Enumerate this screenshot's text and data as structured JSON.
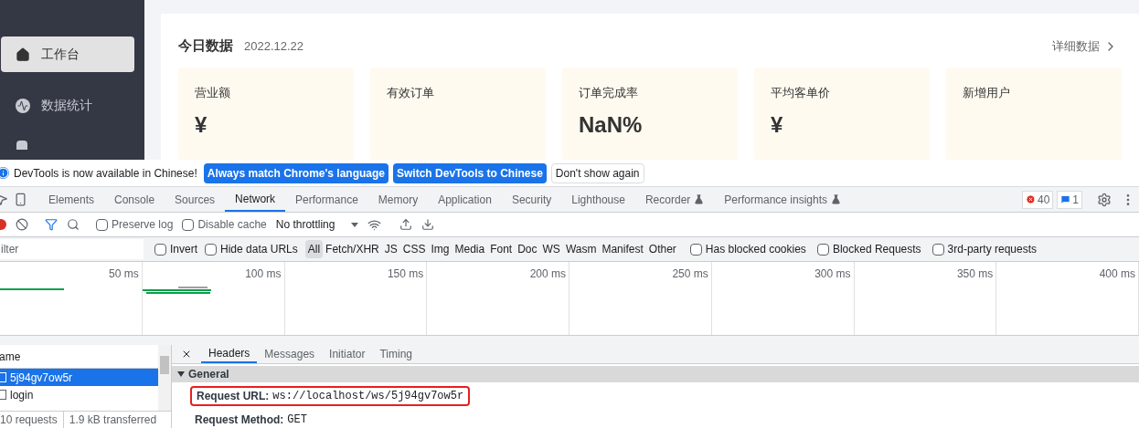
{
  "sidebar": {
    "items": [
      {
        "label": "工作台",
        "selected": true
      },
      {
        "label": "数据统计",
        "selected": false
      }
    ]
  },
  "dashboard": {
    "title": "今日数据",
    "date": "2022.12.22",
    "more": "详细数据",
    "cards": [
      {
        "label": "营业额",
        "value": "¥"
      },
      {
        "label": "有效订单"
      },
      {
        "label": "订单完成率",
        "value": "NaN%"
      },
      {
        "label": "平均客单价",
        "value": "¥"
      },
      {
        "label": "新增用户"
      }
    ]
  },
  "infobar": {
    "message": "DevTools is now available in Chinese!",
    "buttons": [
      {
        "label": "Always match Chrome's language",
        "primary": true
      },
      {
        "label": "Switch DevTools to Chinese",
        "primary": true
      },
      {
        "label": "Don't show again",
        "primary": false
      }
    ]
  },
  "devtools_tabs": [
    {
      "label": "Elements",
      "selected": false,
      "experimental": false
    },
    {
      "label": "Console",
      "selected": false,
      "experimental": false
    },
    {
      "label": "Sources",
      "selected": false,
      "experimental": false
    },
    {
      "label": "Network",
      "selected": true,
      "experimental": false
    },
    {
      "label": "Performance",
      "selected": false,
      "experimental": false
    },
    {
      "label": "Memory",
      "selected": false,
      "experimental": false
    },
    {
      "label": "Application",
      "selected": false,
      "experimental": false
    },
    {
      "label": "Security",
      "selected": false,
      "experimental": false
    },
    {
      "label": "Lighthouse",
      "selected": false,
      "experimental": false
    },
    {
      "label": "Recorder",
      "selected": false,
      "experimental": true
    },
    {
      "label": "Performance insights",
      "selected": false,
      "experimental": true
    }
  ],
  "error_count": "40",
  "message_count": "1",
  "toolbar": {
    "preserve_log": {
      "label": "Preserve log",
      "checked": false
    },
    "disable_cache": {
      "label": "Disable cache",
      "checked": false
    },
    "throttling": "No throttling"
  },
  "filter": {
    "placeholder": "ilter",
    "invert": {
      "label": "Invert",
      "checked": false
    },
    "hide_data_urls": {
      "label": "Hide data URLs",
      "checked": false
    },
    "types": [
      {
        "label": "All",
        "selected": true
      },
      {
        "label": "Fetch/XHR",
        "selected": false
      },
      {
        "label": "JS",
        "selected": false
      },
      {
        "label": "CSS",
        "selected": false
      },
      {
        "label": "Img",
        "selected": false
      },
      {
        "label": "Media",
        "selected": false
      },
      {
        "label": "Font",
        "selected": false
      },
      {
        "label": "Doc",
        "selected": false
      },
      {
        "label": "WS",
        "selected": false
      },
      {
        "label": "Wasm",
        "selected": false
      },
      {
        "label": "Manifest",
        "selected": false
      },
      {
        "label": "Other",
        "selected": false
      }
    ],
    "options": [
      {
        "label": "Has blocked cookies",
        "checked": false
      },
      {
        "label": "Blocked Requests",
        "checked": false
      },
      {
        "label": "3rd-party requests",
        "checked": false
      }
    ]
  },
  "timeline": {
    "ticks": [
      "50 ms",
      "100 ms",
      "150 ms",
      "200 ms",
      "250 ms",
      "300 ms",
      "350 ms",
      "400 ms"
    ]
  },
  "requests": {
    "column": "ame",
    "rows": [
      {
        "name": "5j94gv7ow5r",
        "selected": true
      },
      {
        "name": "login",
        "selected": false
      }
    ]
  },
  "detail_tabs": [
    {
      "label": "Headers",
      "selected": true
    },
    {
      "label": "Messages",
      "selected": false
    },
    {
      "label": "Initiator",
      "selected": false
    },
    {
      "label": "Timing",
      "selected": false
    }
  ],
  "general": {
    "title": "General",
    "expanded": true,
    "rows": [
      {
        "key": "Request URL:",
        "value": "ws://localhost/ws/5j94gv7ow5r",
        "outlined": true
      },
      {
        "key": "Request Method:",
        "value": "GET",
        "outlined": false
      }
    ]
  },
  "status_bar": {
    "requests": "10 requests",
    "transferred": "1.9 kB transferred"
  }
}
